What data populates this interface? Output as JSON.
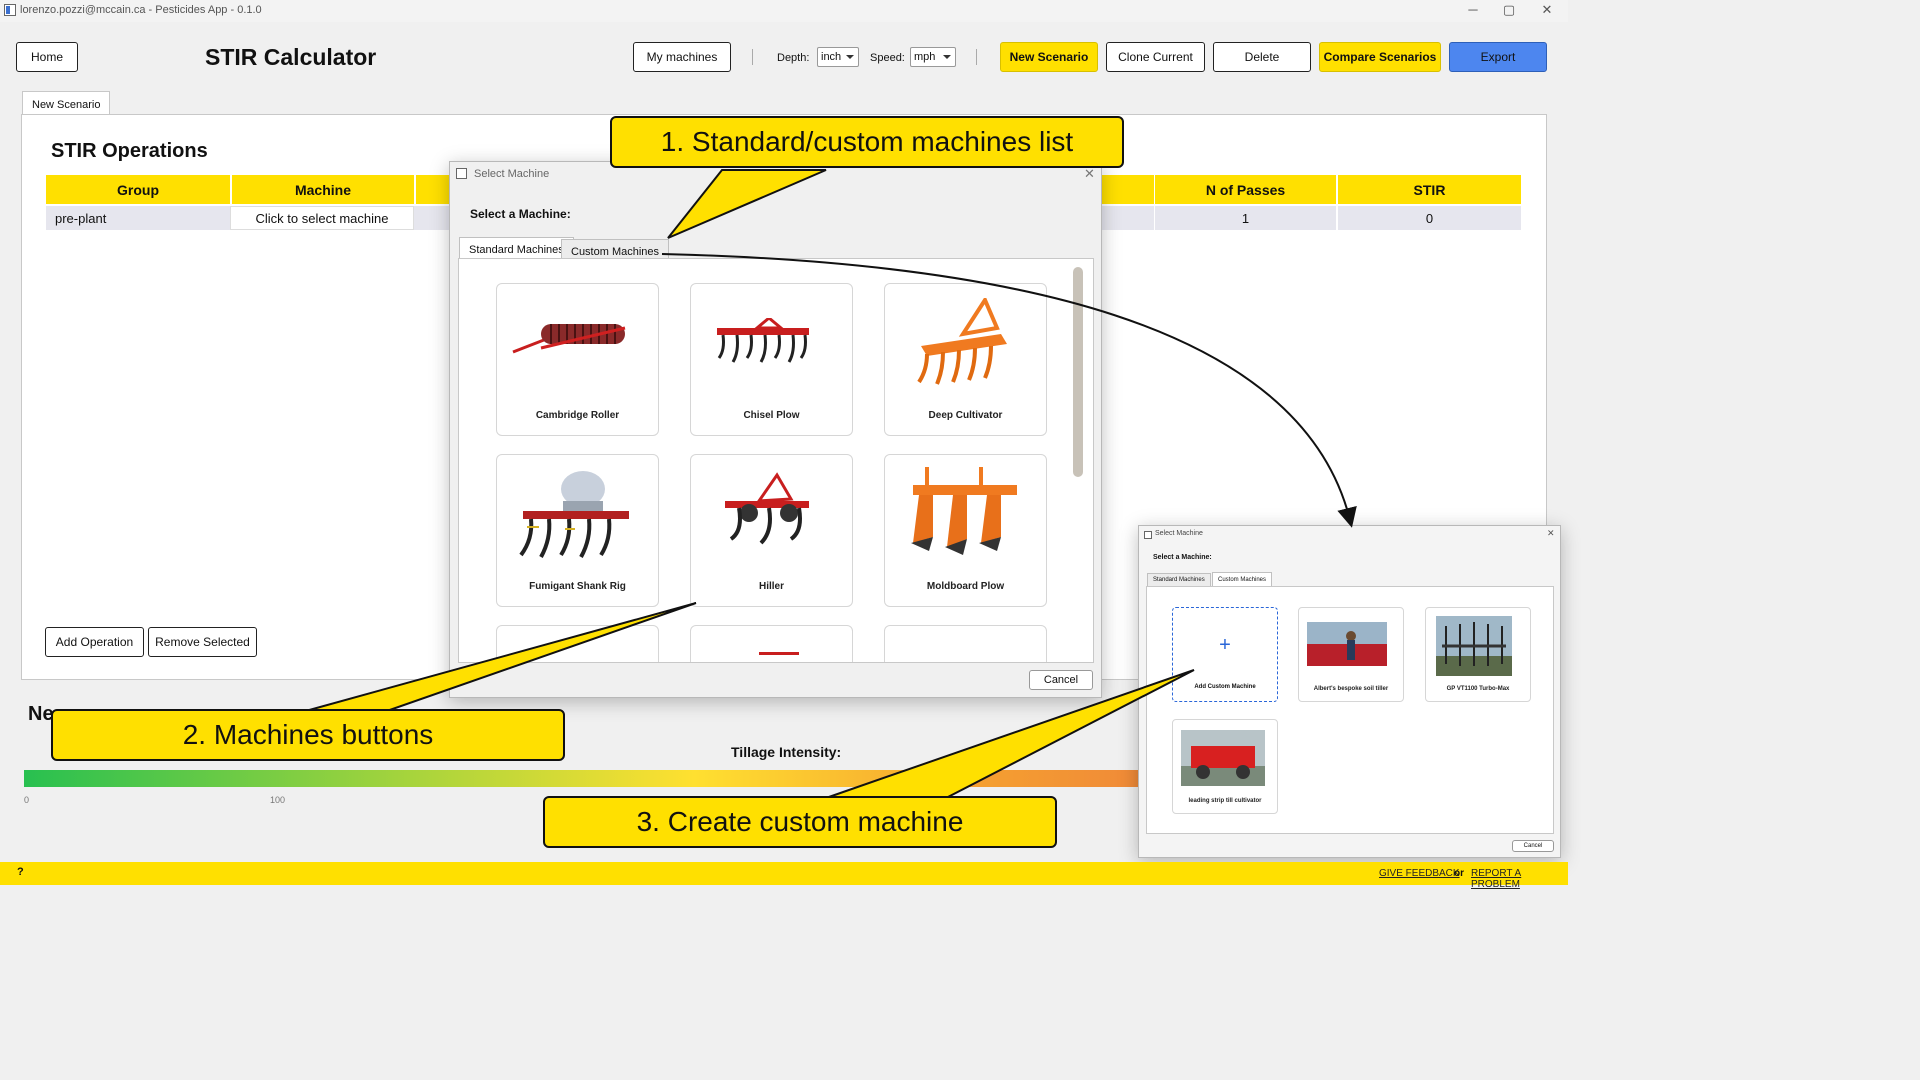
{
  "window": {
    "title": "lorenzo.pozzi@mccain.ca - Pesticides App - 0.1.0",
    "controls": {
      "minimize": "─",
      "restore": "▢",
      "close": "✕"
    }
  },
  "header": {
    "home_label": "Home",
    "page_title": "STIR Calculator",
    "my_machines_label": "My machines",
    "depth_label": "Depth:",
    "depth_value": "inch",
    "speed_label": "Speed:",
    "speed_value": "mph",
    "new_scenario_label": "New Scenario",
    "clone_label": "Clone Current",
    "delete_label": "Delete",
    "compare_label": "Compare Scenarios",
    "export_label": "Export"
  },
  "scenario_tab": {
    "label": "New Scenario"
  },
  "operations": {
    "heading": "STIR Operations",
    "columns": {
      "group": "Group",
      "machine": "Machine",
      "passes": "N of Passes",
      "stir": "STIR"
    },
    "rows": [
      {
        "group": "pre-plant",
        "machine": "Click to select machine",
        "passes": "1",
        "stir": "0"
      }
    ],
    "add_label": "Add Operation",
    "remove_label": "Remove Selected"
  },
  "summary": {
    "heading_fragment": "Ne",
    "tillage_label": "Tillage Intensity:",
    "tick_0": "0",
    "tick_100": "100"
  },
  "select_dialog": {
    "title": "Select Machine",
    "prompt": "Select a Machine:",
    "tabs": [
      "Standard Machines",
      "Custom Machines"
    ],
    "machines": [
      "Cambridge Roller",
      "Chisel Plow",
      "Deep Cultivator",
      "Fumigant Shank Rig",
      "Hiller",
      "Moldboard Plow"
    ],
    "cancel_label": "Cancel"
  },
  "custom_dialog": {
    "title": "Select Machine",
    "prompt": "Select a Machine:",
    "tabs": [
      "Standard Machines",
      "Custom Machines"
    ],
    "add_label": "Add Custom Machine",
    "plus": "+",
    "machines": [
      "Albert's bespoke soil tiller",
      "GP VT1100 Turbo-Max",
      "leading strip till cultivator"
    ],
    "cancel_label": "Cancel"
  },
  "callouts": {
    "one": "1. Standard/custom machines list",
    "two": "2. Machines buttons",
    "three": "3. Create custom machine"
  },
  "footer": {
    "help": "?",
    "feedback": "GIVE FEEDBACK",
    "or": "or",
    "report": "REPORT A PROBLEM"
  },
  "colors": {
    "accent_yellow": "#ffe000",
    "export_blue": "#4d86ef"
  }
}
